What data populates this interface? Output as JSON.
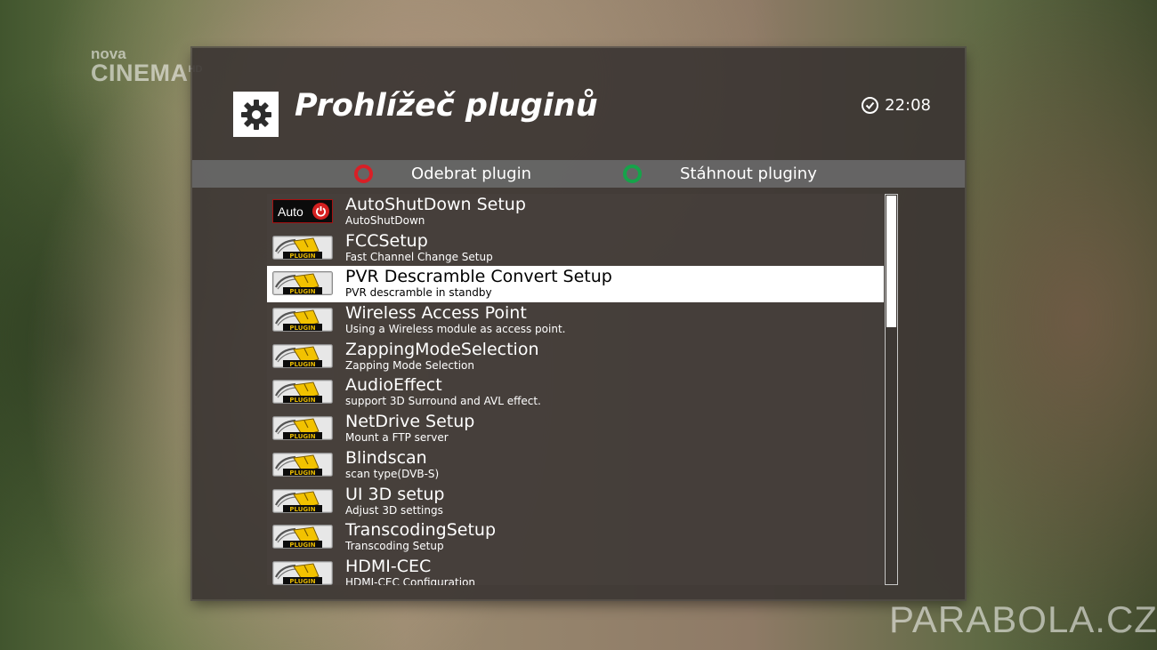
{
  "channel_logo": {
    "line1": "nova",
    "line2": "CINEMA",
    "suffix": "HD"
  },
  "watermark": "PARABOLA.CZ",
  "header": {
    "icon": "gear-icon",
    "title": "Prohlížeč pluginů",
    "clock_icon": "clock-icon",
    "time": "22:08"
  },
  "buttons": {
    "red": {
      "label": "Odebrat plugin",
      "color": "#d81f26"
    },
    "green": {
      "label": "Stáhnout pluginy",
      "color": "#16a34a"
    }
  },
  "plugin_list": {
    "selected_index": 2,
    "items": [
      {
        "name": "AutoShutDown Setup",
        "description": "AutoShutDown",
        "icon": "auto-power-icon",
        "icon_text": "Auto"
      },
      {
        "name": "FCCSetup",
        "description": "Fast Channel Change Setup",
        "icon": "plugin-icon",
        "icon_text": "PLUGIN"
      },
      {
        "name": "PVR Descramble Convert Setup",
        "description": "PVR descramble in standby",
        "icon": "plugin-icon",
        "icon_text": "PLUGIN"
      },
      {
        "name": "Wireless Access Point",
        "description": "Using a Wireless module as access point.",
        "icon": "plugin-icon",
        "icon_text": "PLUGIN"
      },
      {
        "name": "ZappingModeSelection",
        "description": "Zapping Mode Selection",
        "icon": "plugin-icon",
        "icon_text": "PLUGIN"
      },
      {
        "name": "AudioEffect",
        "description": "support 3D Surround and AVL effect.",
        "icon": "plugin-icon",
        "icon_text": "PLUGIN"
      },
      {
        "name": "NetDrive Setup",
        "description": "Mount a FTP server",
        "icon": "plugin-icon",
        "icon_text": "PLUGIN"
      },
      {
        "name": "Blindscan",
        "description": "scan type(DVB-S)",
        "icon": "plugin-icon",
        "icon_text": "PLUGIN"
      },
      {
        "name": "UI 3D setup",
        "description": "Adjust 3D settings",
        "icon": "plugin-icon",
        "icon_text": "PLUGIN"
      },
      {
        "name": "TranscodingSetup",
        "description": "Transcoding Setup",
        "icon": "plugin-icon",
        "icon_text": "PLUGIN"
      },
      {
        "name": "HDMI-CEC",
        "description": "HDMI-CEC Configuration",
        "icon": "plugin-icon",
        "icon_text": "PLUGIN"
      }
    ]
  },
  "scrollbar": {
    "position": 0,
    "visible_fraction": 0.34
  }
}
